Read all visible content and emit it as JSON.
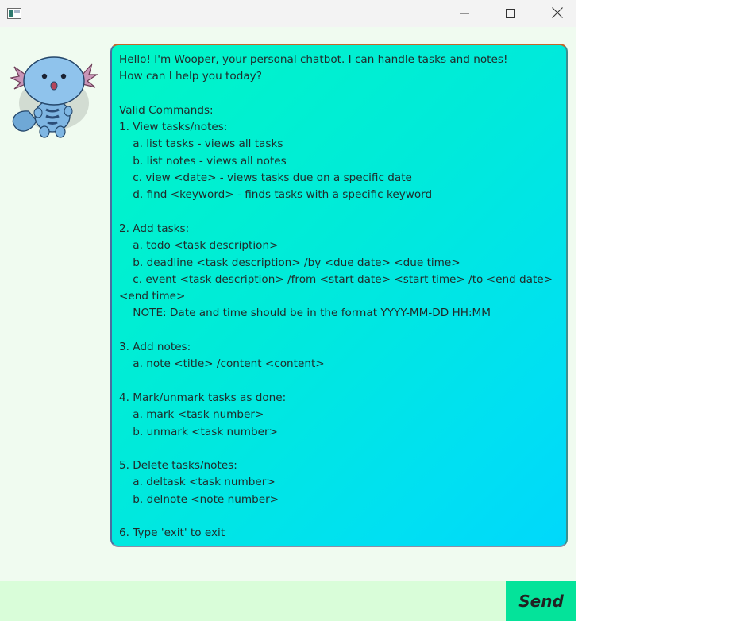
{
  "window": {
    "controls": {
      "minimize_icon": "minimize-icon",
      "maximize_icon": "maximize-icon",
      "close_icon": "close-icon"
    }
  },
  "chat": {
    "avatar_icon": "wooper-avatar",
    "bot_message_lines": [
      "Hello! I'm Wooper, your personal chatbot. I can handle tasks and notes!",
      "How can I help you today?",
      "",
      "Valid Commands:",
      "1. View tasks/notes:",
      "    a. list tasks - views all tasks",
      "    b. list notes - views all notes",
      "    c. view <date> - views tasks due on a specific date",
      "    d. find <keyword> - finds tasks with a specific keyword",
      "",
      "2. Add tasks:",
      "    a. todo <task description>",
      "    b. deadline <task description> /by <due date> <due time>",
      "    c. event <task description> /from <start date> <start time> /to <end date>",
      "<end time>",
      "    NOTE: Date and time should be in the format YYYY-MM-DD HH:MM",
      "",
      "3. Add notes:",
      "    a. note <title> /content <content>",
      "",
      "4. Mark/unmark tasks as done:",
      "    a. mark <task number>",
      "    b. unmark <task number>",
      "",
      "5. Delete tasks/notes:",
      "    a. deltask <task number>",
      "    b. delnote <note number>",
      "",
      "6. Type 'exit' to exit"
    ]
  },
  "input": {
    "value": "",
    "placeholder": ""
  },
  "send_button": {
    "label": "Send"
  },
  "colors": {
    "background": "#f0fbf0",
    "bubble_gradient_start": "#00f6c6",
    "bubble_gradient_end": "#00d8fb",
    "input_background": "#d9fdd9",
    "send_button": "#04e39a"
  }
}
